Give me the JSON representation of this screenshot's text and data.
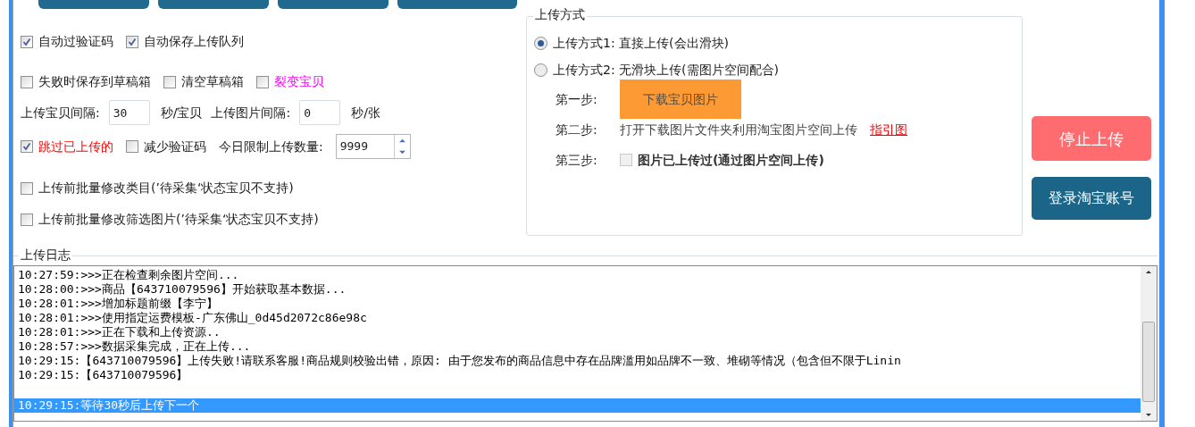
{
  "options": {
    "lines": [
      {
        "items": [
          {
            "kind": "checkbox",
            "label": "自动过验证码",
            "checked": true
          },
          {
            "kind": "checkbox",
            "label": "自动保存上传队列",
            "checked": true
          }
        ]
      },
      {
        "items": [
          {
            "kind": "checkbox",
            "label": "失败时保存到草稿箱",
            "checked": false
          },
          {
            "kind": "checkbox",
            "label": "清空草稿箱",
            "checked": false
          },
          {
            "kind": "checkbox",
            "label": "裂变宝贝",
            "checked": false,
            "color": "#ff00ff"
          }
        ]
      },
      {
        "items": [
          {
            "kind": "label",
            "label": "上传宝贝间隔:"
          },
          {
            "kind": "field",
            "value": "30"
          },
          {
            "kind": "label",
            "label": "秒/宝贝"
          },
          {
            "kind": "label",
            "label": "上传图片间隔:"
          },
          {
            "kind": "field",
            "value": "0"
          },
          {
            "kind": "label",
            "label": "秒/张"
          }
        ]
      },
      {
        "items": [
          {
            "kind": "checkbox",
            "label": "跳过已上传的",
            "checked": true,
            "color": "#ff0000"
          },
          {
            "kind": "checkbox",
            "label": "减少验证码",
            "checked": false
          },
          {
            "kind": "label",
            "label": "今日限制上传数量:"
          },
          {
            "kind": "spinner",
            "value": "9999"
          }
        ]
      },
      {
        "items": [
          {
            "kind": "checkbox",
            "label": "上传前批量修改类目(’待采集‘状态宝贝不支持)",
            "checked": false
          }
        ]
      },
      {
        "items": [
          {
            "kind": "checkbox",
            "label": "上传前批量修改筛选图片(’待采集‘状态宝贝不支持)",
            "checked": false
          }
        ]
      }
    ]
  },
  "upload_method": {
    "title": "上传方式",
    "radios": [
      {
        "label": "上传方式1: 直接上传(会出滑块)",
        "selected": true
      },
      {
        "label": "上传方式2: 无滑块上传(需图片空间配合)",
        "selected": false
      }
    ],
    "steps": [
      {
        "kind": "button",
        "label": "第一步:",
        "button": "下载宝贝图片"
      },
      {
        "kind": "text",
        "label": "第二步:",
        "text": "打开下载图片文件夹利用淘宝图片空间上传",
        "link": "指引图"
      },
      {
        "kind": "checkbox",
        "label": "第三步:",
        "checkbox": "图片已上传过(通过图片空间上传)",
        "checked": false
      }
    ]
  },
  "actions": [
    {
      "kind": "stop",
      "label": "停止上传"
    },
    {
      "kind": "login",
      "label": "登录淘宝账号"
    }
  ],
  "log": {
    "title": "上传日志",
    "lines": [
      {
        "text": "10:27:59:>>>正在检查剩余图片空间...",
        "selected": false
      },
      {
        "text": "10:28:00:>>>商品【643710079596】开始获取基本数据...",
        "selected": false
      },
      {
        "text": "10:28:01:>>>增加标题前缀【李宁】",
        "selected": false
      },
      {
        "text": "10:28:01:>>>使用指定运费模板-广东佛山_0d45d2072c86e98c",
        "selected": false
      },
      {
        "text": "10:28:01:>>>正在下载和上传资源..",
        "selected": false
      },
      {
        "text": "10:28:57:>>>数据采集完成，正在上传...",
        "selected": false
      },
      {
        "text": "10:29:15:【643710079596】上传失败!请联系客服!商品规则校验出错，原因: 由于您发布的商品信息中存在品牌滥用如品牌不一致、堆砌等情况（包含但不限于Linin",
        "selected": false
      },
      {
        "text": "10:29:15:【643710079596】",
        "selected": false
      },
      {
        "text": "10:29:15:等待30秒后上传下一个",
        "selected": true
      }
    ]
  }
}
